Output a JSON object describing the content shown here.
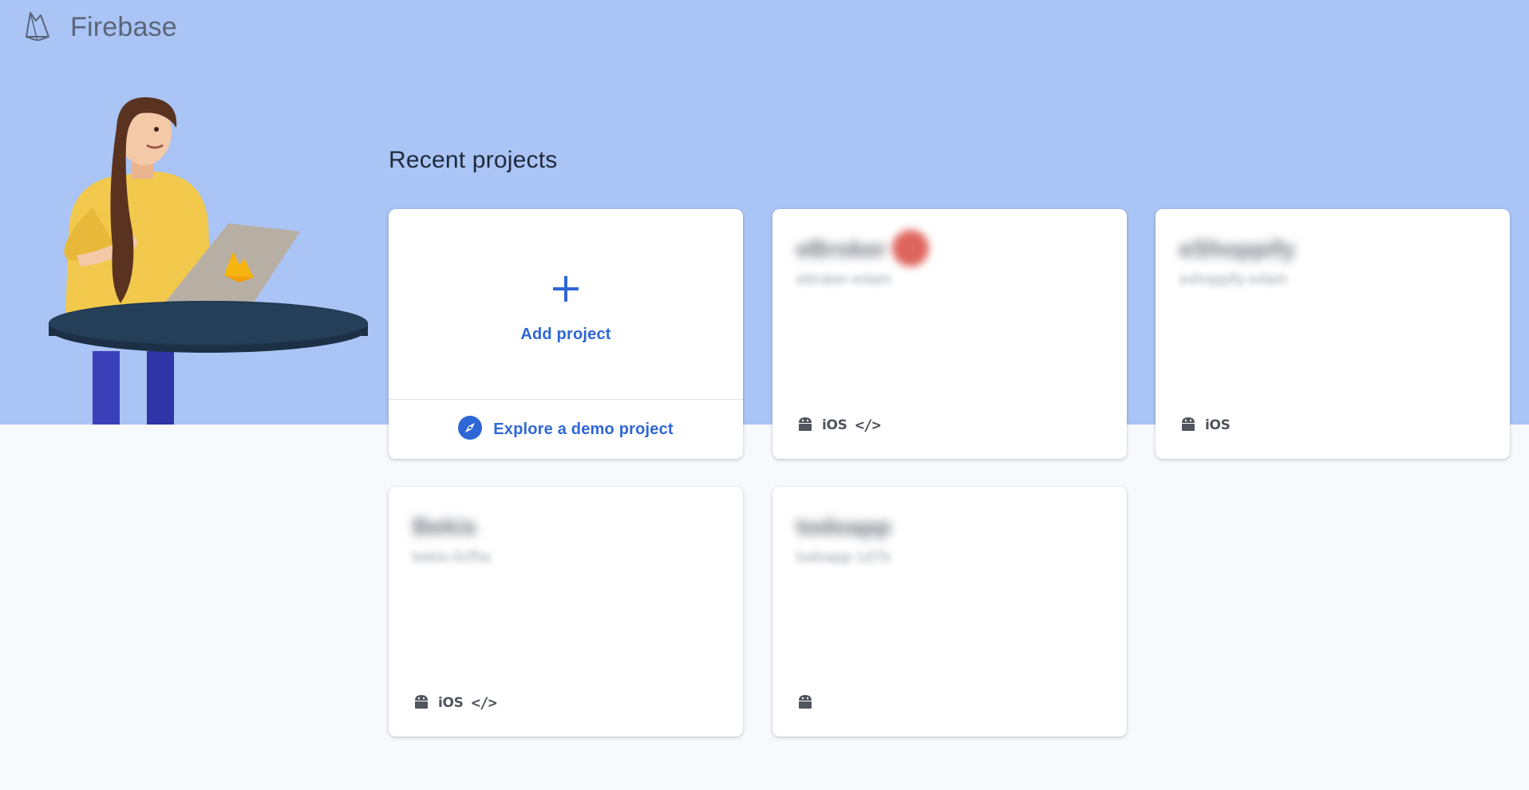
{
  "app": {
    "brand_name": "Firebase",
    "accent_color": "#2f66d6",
    "hero_color": "#a9c4f5"
  },
  "section": {
    "title": "Recent projects"
  },
  "add_card": {
    "add_label": "Add project",
    "demo_label": "Explore a demo project",
    "plus_icon": "plus-icon",
    "demo_icon": "compass-icon"
  },
  "projects": [
    {
      "name": "eBroker",
      "id": "ebroker-e4am",
      "has_badge": true,
      "platforms": [
        "android",
        "ios",
        "web"
      ],
      "ios_label": "iOS",
      "web_label": "</>"
    },
    {
      "name": "eShoppify",
      "id": "eshoppify-e4am",
      "has_badge": false,
      "platforms": [
        "android",
        "ios"
      ],
      "ios_label": "iOS",
      "web_label": ""
    },
    {
      "name": "Bekis",
      "id": "bekis-0cf5a",
      "has_badge": false,
      "platforms": [
        "android",
        "ios",
        "web"
      ],
      "ios_label": "iOS",
      "web_label": "</>"
    },
    {
      "name": "todoapp",
      "id": "todoapp-1d7b",
      "has_badge": false,
      "platforms": [
        "android"
      ],
      "ios_label": "",
      "web_label": ""
    }
  ]
}
